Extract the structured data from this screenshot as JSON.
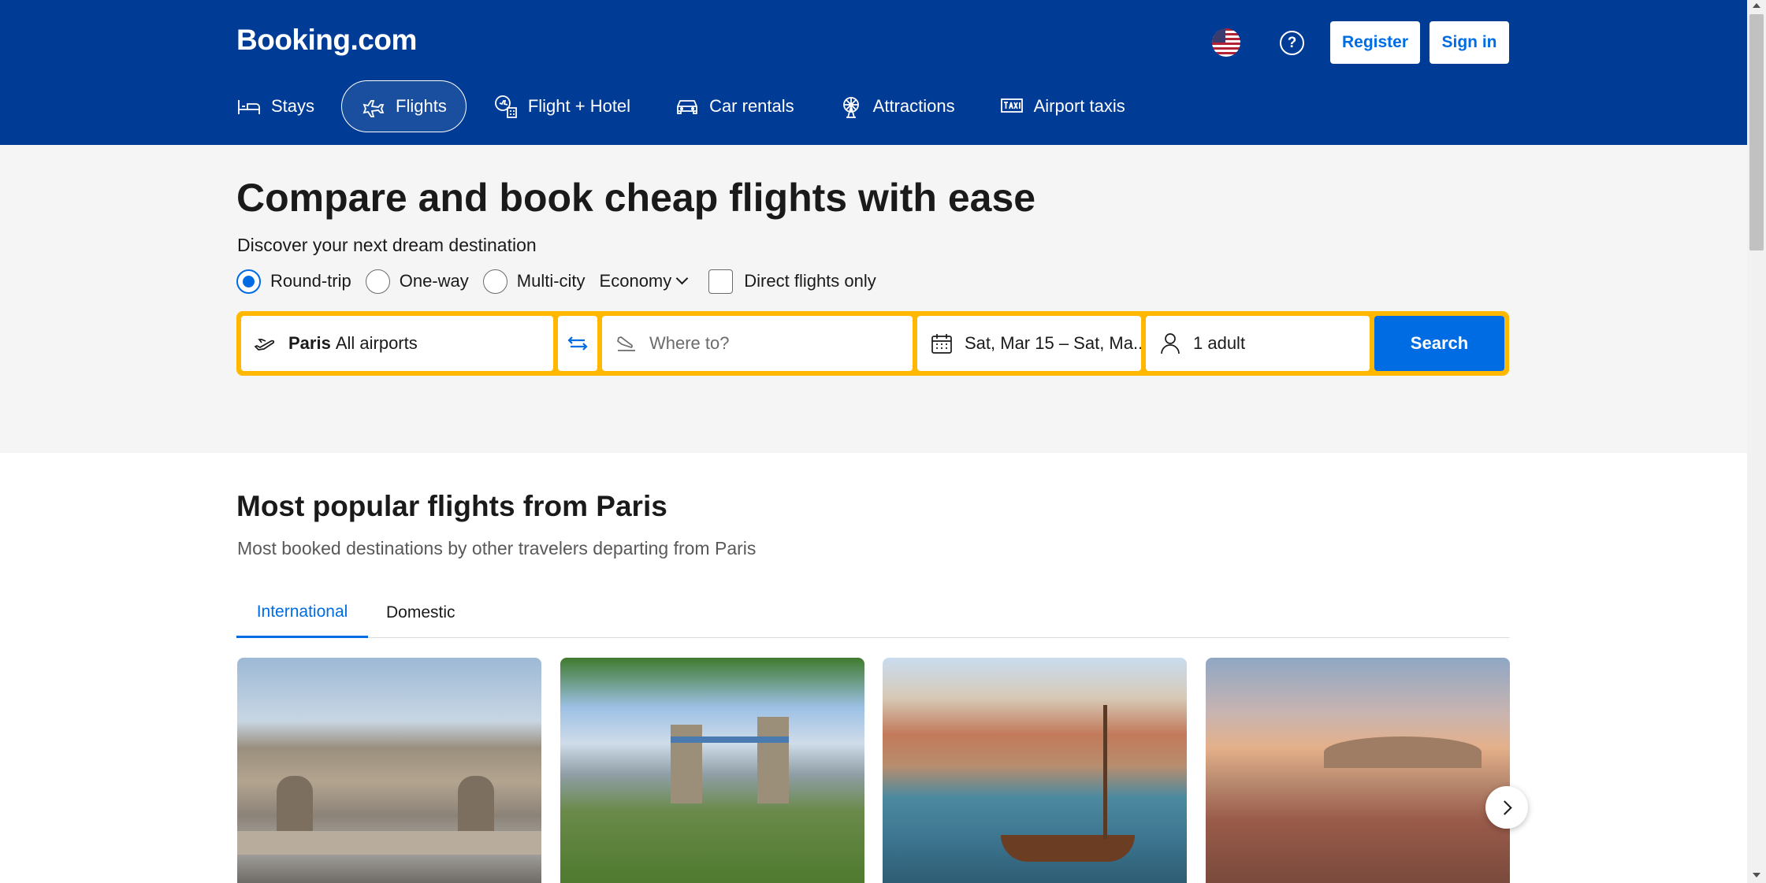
{
  "header": {
    "logo": "Booking.com",
    "help_symbol": "?",
    "register_label": "Register",
    "signin_label": "Sign in",
    "flag_icon": "us-flag-icon",
    "colors": {
      "brand": "#003b95",
      "accent": "#006ce4",
      "search_border": "#ffb700"
    }
  },
  "nav": {
    "items": [
      {
        "label": "Stays",
        "icon": "bed-icon"
      },
      {
        "label": "Flights",
        "icon": "plane-icon",
        "active": true
      },
      {
        "label": "Flight + Hotel",
        "icon": "plane-hotel-icon"
      },
      {
        "label": "Car rentals",
        "icon": "car-icon"
      },
      {
        "label": "Attractions",
        "icon": "ferris-wheel-icon"
      },
      {
        "label": "Airport taxis",
        "icon": "taxi-icon"
      }
    ]
  },
  "hero": {
    "title": "Compare and book cheap flights with ease",
    "subtitle": "Discover your next dream destination"
  },
  "options": {
    "round_trip": "Round-trip",
    "one_way": "One-way",
    "multi_city": "Multi-city",
    "cabin_class": "Economy",
    "direct_only": "Direct flights only",
    "selected_trip": "Round-trip"
  },
  "search": {
    "from_city": "Paris",
    "from_airports": "All airports",
    "to_placeholder": "Where to?",
    "dates": "Sat, Mar 15 – Sat, Ma...",
    "travelers": "1 adult",
    "button": "Search"
  },
  "popular": {
    "title": "Most popular flights from Paris",
    "subtitle": "Most booked destinations by other travelers departing from Paris",
    "tabs": [
      {
        "label": "International",
        "active": true
      },
      {
        "label": "Domestic"
      }
    ]
  }
}
